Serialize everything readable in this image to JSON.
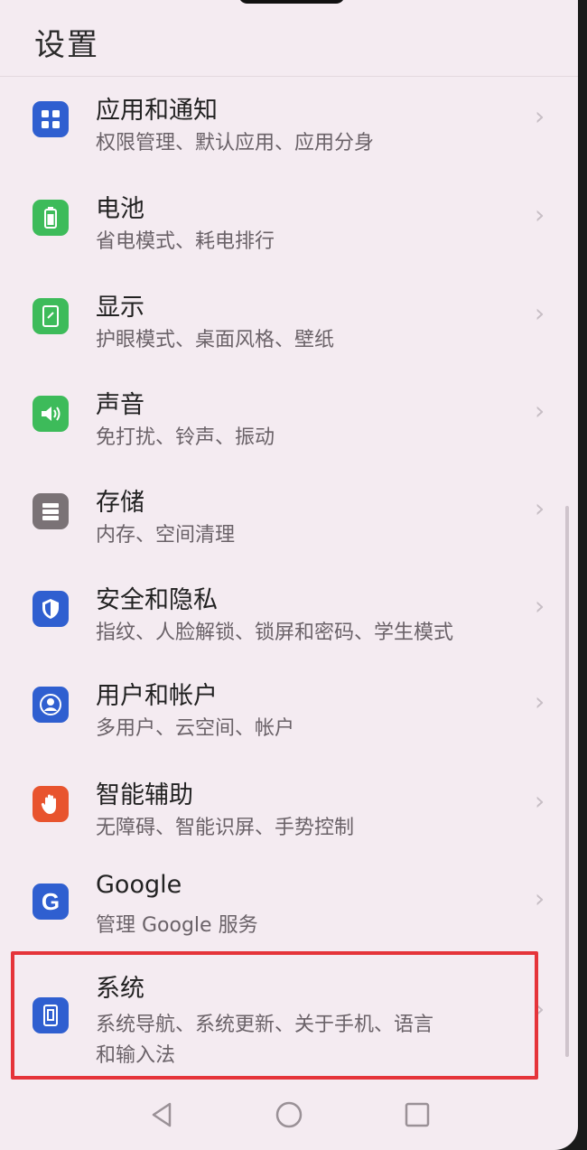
{
  "header": {
    "title": "设置"
  },
  "items": [
    {
      "label": "应用和通知",
      "sub": "权限管理、默认应用、应用分身",
      "icon": "apps-grid-icon",
      "color": "#2f5fd0"
    },
    {
      "label": "电池",
      "sub": "省电模式、耗电排行",
      "icon": "battery-icon",
      "color": "#3dbb5a"
    },
    {
      "label": "显示",
      "sub": "护眼模式、桌面风格、壁纸",
      "icon": "display-icon",
      "color": "#3dbb5a"
    },
    {
      "label": "声音",
      "sub": "免打扰、铃声、振动",
      "icon": "speaker-icon",
      "color": "#3dbb5a"
    },
    {
      "label": "存储",
      "sub": "内存、空间清理",
      "icon": "storage-icon",
      "color": "#7a7276"
    },
    {
      "label": "安全和隐私",
      "sub": "指纹、人脸解锁、锁屏和密码、学生模式",
      "icon": "shield-icon",
      "color": "#2f5fd0"
    },
    {
      "label": "用户和帐户",
      "sub": "多用户、云空间、帐户",
      "icon": "user-icon",
      "color": "#2f5fd0"
    },
    {
      "label": "智能辅助",
      "sub": "无障碍、智能识屏、手势控制",
      "icon": "hand-icon",
      "color": "#e8542e"
    },
    {
      "label": "Google",
      "sub": "管理 Google 服务",
      "icon": "google-icon",
      "color": "#2f5fd0"
    },
    {
      "label": "系统",
      "sub": "系统导航、系统更新、关于手机、语言",
      "sub2": "和输入法",
      "icon": "phone-system-icon",
      "color": "#2f5fd0"
    }
  ],
  "chevron": "›",
  "accent": {
    "highlight": "#e5343a"
  },
  "navbar": {
    "back": "back-icon",
    "home": "home-icon",
    "recents": "recents-icon"
  }
}
